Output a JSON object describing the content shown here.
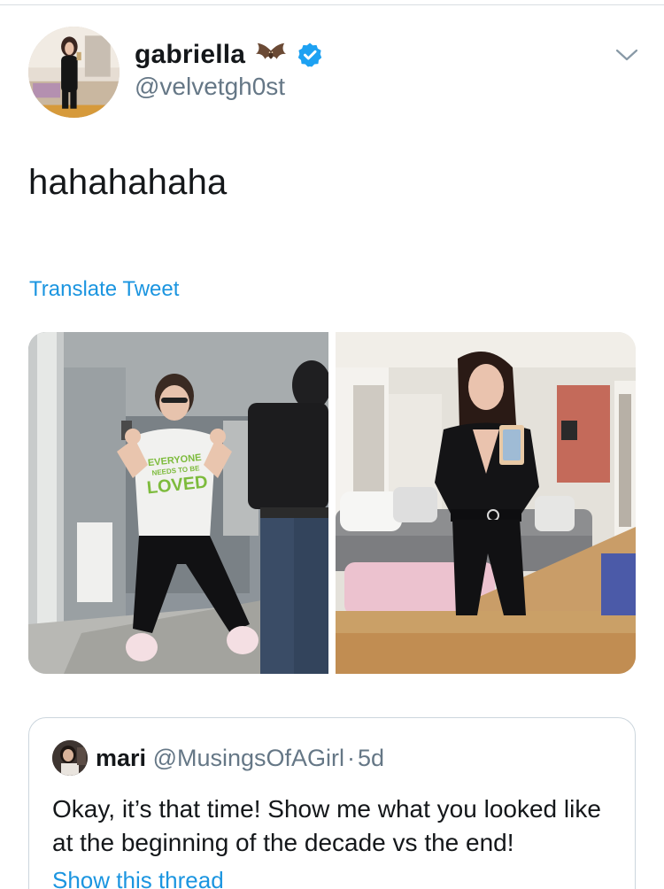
{
  "tweet": {
    "display_name": "gabriella",
    "name_emoji": "bat-icon",
    "verified": true,
    "handle": "@velvetgh0st",
    "text": "hahahahaha",
    "translate_label": "Translate Tweet",
    "media": [
      {
        "name": "photo-before",
        "shirt_lines": [
          "EVERYONE",
          "NEEDS TO BE",
          "LOVED"
        ]
      },
      {
        "name": "photo-after"
      }
    ]
  },
  "quoted_tweet": {
    "display_name": "mari",
    "handle": "@MusingsOfAGirl",
    "separator": "·",
    "time": "5d",
    "text": "Okay, it’s that time! Show me what you looked like at the beginning of the decade vs the end!",
    "show_thread_label": "Show this thread"
  },
  "colors": {
    "link": "#1b95e0",
    "verified": "#1da1f2",
    "secondary_text": "#657786",
    "border": "#ccd6dd"
  }
}
